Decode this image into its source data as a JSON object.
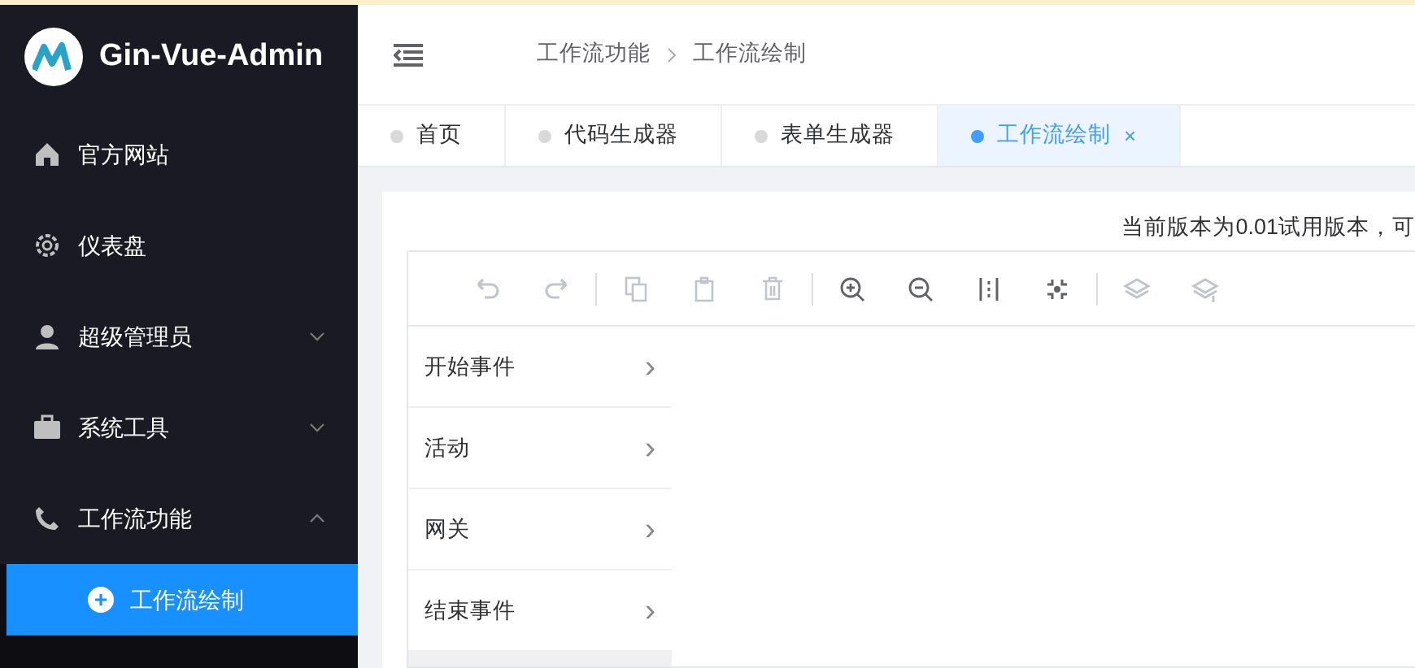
{
  "brand": {
    "title": "Gin-Vue-Admin"
  },
  "sidebar": {
    "items": [
      {
        "label": "官方网站"
      },
      {
        "label": "仪表盘"
      },
      {
        "label": "超级管理员",
        "expanded": false
      },
      {
        "label": "系统工具",
        "expanded": false
      },
      {
        "label": "工作流功能",
        "expanded": true,
        "children": [
          {
            "label": "工作流绘制",
            "selected": true
          }
        ]
      }
    ]
  },
  "breadcrumb": [
    "工作流功能",
    "工作流绘制"
  ],
  "tabs": [
    {
      "label": "首页",
      "selected": false
    },
    {
      "label": "代码生成器",
      "selected": false
    },
    {
      "label": "表单生成器",
      "selected": false
    },
    {
      "label": "工作流绘制",
      "selected": true,
      "close": "×"
    }
  ],
  "notice": "当前版本为0.01试用版本，可",
  "toolbar": [
    {
      "disabled": true
    },
    {
      "disabled": true
    },
    {
      "disabled": true
    },
    {
      "disabled": true
    },
    {
      "disabled": true
    },
    {
      "disabled": false
    },
    {
      "disabled": false
    },
    {
      "disabled": false
    },
    {
      "disabled": false
    },
    {
      "disabled": true
    },
    {
      "disabled": true
    }
  ],
  "palette": [
    {
      "label": "开始事件",
      "chevron": "›"
    },
    {
      "label": "活动",
      "chevron": "›"
    },
    {
      "label": "网关",
      "chevron": "›"
    },
    {
      "label": "结束事件",
      "chevron": "›"
    }
  ]
}
